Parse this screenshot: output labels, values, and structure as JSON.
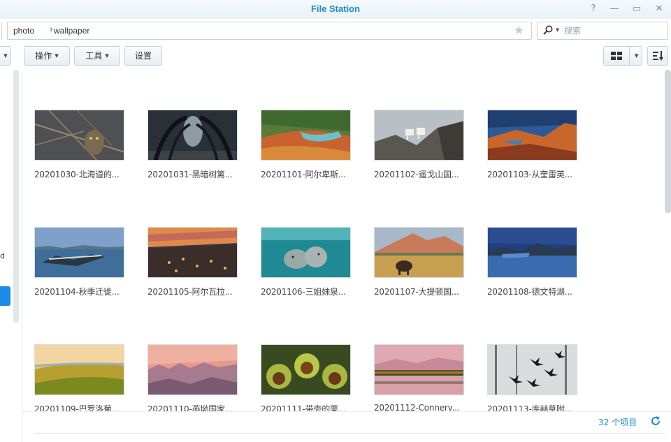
{
  "window": {
    "title": "File Station",
    "help_glyph": "?",
    "min_glyph": "—",
    "max_glyph": "▭",
    "close_glyph": "✕"
  },
  "breadcrumb": [
    "photo",
    "wallpaper"
  ],
  "breadcrumb_sep": "›",
  "search": {
    "placeholder": "搜索"
  },
  "toolbar": {
    "actions_label": "操作",
    "tools_label": "工具",
    "settings_label": "设置"
  },
  "left": {
    "fragment": "d"
  },
  "colors": {
    "accent": "#1b8ad8",
    "title": "#1b8ad8",
    "selected": "#1a8ae6"
  },
  "files": [
    {
      "name": "20201030-北海道的...",
      "icon": "owl-photo"
    },
    {
      "name": "20201031-黑暗树篱...",
      "icon": "dark-hedges-photo"
    },
    {
      "name": "20201101-阿尔卑斯...",
      "icon": "alpine-stream-photo"
    },
    {
      "name": "20201102-遥戈山国...",
      "icon": "mountain-goats-photo"
    },
    {
      "name": "20201103-从奎雷英...",
      "icon": "quiraing-photo"
    },
    {
      "name": "20201104-秋季迁徙...",
      "icon": "geese-lake-photo"
    },
    {
      "name": "20201105-阿尔瓦拉...",
      "icon": "village-dusk-photo"
    },
    {
      "name": "20201106-三姐妹泉...",
      "icon": "manatees-photo"
    },
    {
      "name": "20201107-大提顿国...",
      "icon": "bison-teton-photo"
    },
    {
      "name": "20201108-德文特湖...",
      "icon": "derwent-lake-photo"
    },
    {
      "name": "20201109-巴罗洛葡...",
      "icon": "vineyard-photo"
    },
    {
      "name": "20201110-燕坳国家...",
      "icon": "badlands-photo"
    },
    {
      "name": "20201111-带壳的栗...",
      "icon": "chestnuts-photo"
    },
    {
      "name": "20201112-Connerv...",
      "icon": "misty-lake-photo"
    },
    {
      "name": "20201113-库赫草附...",
      "icon": "crows-snow-photo"
    }
  ],
  "status": {
    "count_text": "32 个项目"
  }
}
